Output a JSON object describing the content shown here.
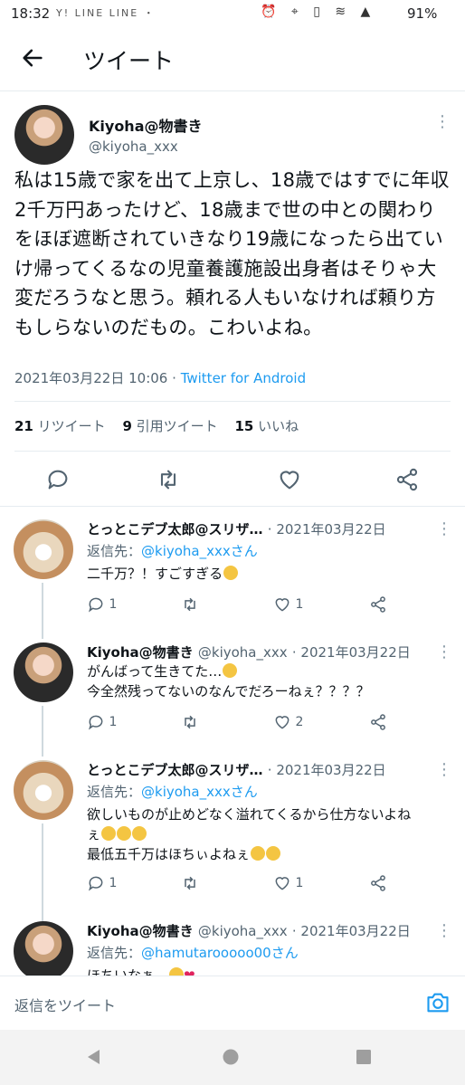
{
  "status_bar": {
    "time": "18:32",
    "left_icons": "Y! LINE  LINE ・",
    "right_icons": "⏰ ⌖ ▯ ≋ ▲",
    "battery": "91%"
  },
  "appbar": {
    "title": "ツイート"
  },
  "main_tweet": {
    "name": "Kiyoha@物書き",
    "handle": "@kiyoha_xxx",
    "text": "私は15歳で家を出て上京し、18歳ではすでに年収2千万円あったけど、18歳まで世の中との関わりをほぼ遮断されていきなり19歳になったら出ていけ帰ってくるなの児童養護施設出身者はそりゃ大変だろうなと思う。頼れる人もいなければ頼り方もしらないのだもの。こわいよね。",
    "date": "2021年03月22日 10:06",
    "separator": "·",
    "client": "Twitter for Android",
    "stats": {
      "retweets_count": "21",
      "retweets_label": "リツイート",
      "quotes_count": "9",
      "quotes_label": "引用ツイート",
      "likes_count": "15",
      "likes_label": "いいね"
    }
  },
  "replies": [
    {
      "name": "とっとこデブ太郎@スリザ…",
      "handle": "",
      "date": "· 2021年03月22日",
      "reply_to_label": "返信先：",
      "reply_to": "@kiyoha_xxxさん",
      "lines": [
        "二千万？！すごすぎる"
      ],
      "reply_count": "1",
      "retweet_count": "",
      "like_count": "1"
    },
    {
      "name": "Kiyoha@物書き",
      "handle": "@kiyoha_xxx",
      "date": "· 2021年03月22日",
      "reply_to_label": "",
      "reply_to": "",
      "lines": [
        "がんばって生きてた…",
        "今全然残ってないのなんでだろーねぇ？？？？"
      ],
      "reply_count": "1",
      "retweet_count": "",
      "like_count": "2"
    },
    {
      "name": "とっとこデブ太郎@スリザ…",
      "handle": "",
      "date": "· 2021年03月22日",
      "reply_to_label": "返信先：",
      "reply_to": "@kiyoha_xxxさん",
      "lines": [
        "欲しいものが止めどなく溢れてくるから仕方ないよね",
        "ぇ",
        "最低五千万はほちぃよねぇ"
      ],
      "reply_count": "1",
      "retweet_count": "",
      "like_count": "1"
    },
    {
      "name": "Kiyoha@物書き",
      "handle": "@kiyoha_xxx",
      "date": "· 2021年03月22日",
      "reply_to_label": "返信先：",
      "reply_to": "@hamutarooooo00さん",
      "lines": [
        "ほちいなぁ…"
      ],
      "reply_count": "",
      "retweet_count": "",
      "like_count": ""
    }
  ],
  "composer": {
    "placeholder": "返信をツイート"
  },
  "icons": {
    "back": "arrow-left-icon",
    "more": "kebab-icon",
    "reply": "comment-icon",
    "retweet": "retweet-icon",
    "like": "heart-icon",
    "share": "share-icon",
    "camera": "camera-icon",
    "nav_back": "triangle-back-icon",
    "nav_home": "circle-home-icon",
    "nav_recents": "square-recents-icon"
  },
  "colors": {
    "accent": "#1d9bf0",
    "text": "#0f1419",
    "muted": "#536471"
  }
}
